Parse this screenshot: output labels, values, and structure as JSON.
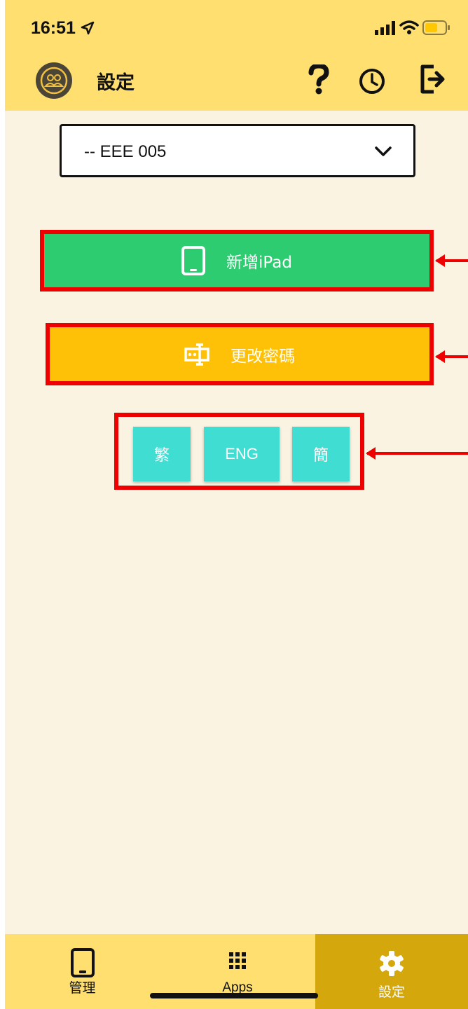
{
  "status_bar": {
    "time": "16:51",
    "icons": [
      "location-arrow-icon",
      "signal-bars-icon",
      "wifi-icon",
      "battery-icon"
    ]
  },
  "header": {
    "title": "設定",
    "icons": [
      "avatar-icon",
      "help-icon",
      "history-clock-icon",
      "logout-icon"
    ]
  },
  "device_select": {
    "value": "-- EEE 005"
  },
  "actions": {
    "add_ipad_label": "新增iPad",
    "change_password_label": "更改密碼"
  },
  "language": {
    "options": [
      "繁",
      "ENG",
      "簡"
    ]
  },
  "tabbar": {
    "tabs": [
      {
        "label": "管理",
        "icon": "tablet-icon"
      },
      {
        "label": "Apps",
        "icon": "grid-icon"
      },
      {
        "label": "設定",
        "icon": "gear-icon",
        "active": true
      }
    ]
  },
  "colors": {
    "header_bg": "#ffdf70",
    "page_bg": "#faf3e2",
    "add_button": "#2ecc71",
    "password_button": "#ffc107",
    "language_button": "#40ddd2",
    "annotation_red": "#ee0000",
    "active_tab": "#d4a80c"
  }
}
